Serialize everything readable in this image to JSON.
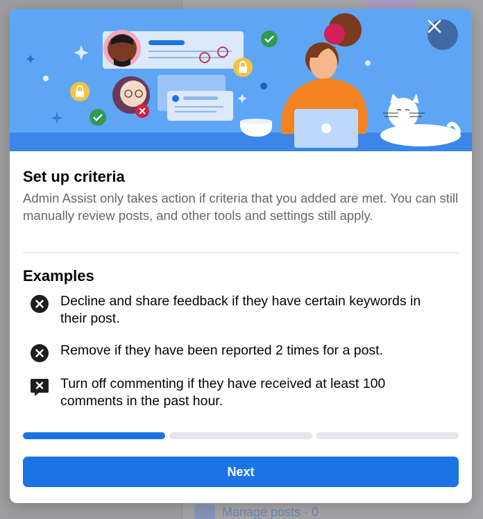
{
  "background": {
    "footer_label": "Manage posts · 0"
  },
  "dialog": {
    "title": "Set up criteria",
    "description": "Admin Assist only takes action if criteria that you added are met. You can still manually review posts, and other tools and settings still apply.",
    "examples_title": "Examples",
    "examples": [
      {
        "icon": "x-circle-icon",
        "text": "Decline and share feedback if they have certain keywords in their post."
      },
      {
        "icon": "x-circle-icon",
        "text": "Remove if they have been reported 2 times for a post."
      },
      {
        "icon": "comment-off-icon",
        "text": "Turn off commenting if they have received at least 100 comments in the past hour."
      }
    ],
    "progress": {
      "current_step": 1,
      "total_steps": 3
    },
    "next_label": "Next",
    "close_icon": "close-icon"
  },
  "colors": {
    "accent": "#1b74e4",
    "hero_background": "#5ea6f5",
    "close_button": "#3f6aa3",
    "text_primary": "#050505",
    "text_secondary": "#65676b"
  }
}
